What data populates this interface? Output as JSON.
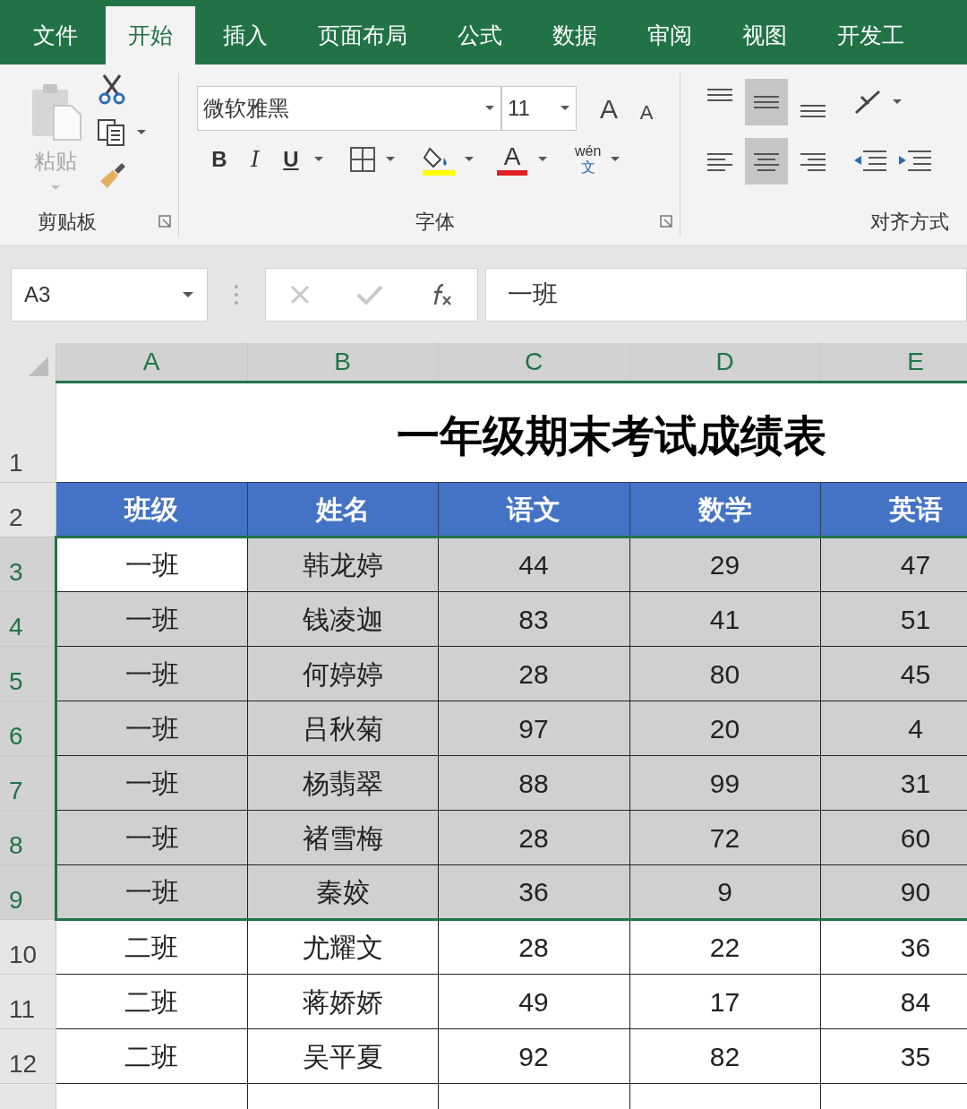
{
  "tabs": [
    {
      "label": "文件",
      "selected": false
    },
    {
      "label": "开始",
      "selected": true
    },
    {
      "label": "插入",
      "selected": false
    },
    {
      "label": "页面布局",
      "selected": false
    },
    {
      "label": "公式",
      "selected": false
    },
    {
      "label": "数据",
      "selected": false
    },
    {
      "label": "审阅",
      "selected": false
    },
    {
      "label": "视图",
      "selected": false
    },
    {
      "label": "开发工",
      "selected": false
    }
  ],
  "ribbon": {
    "clipboard": {
      "paste_label": "粘贴",
      "paste_disabled": true,
      "group_label": "剪贴板"
    },
    "font": {
      "font_name": "微软雅黑",
      "font_size": "11",
      "grow": "A",
      "shrink": "A",
      "bold": "B",
      "italic": "I",
      "underline": "U",
      "font_color": "A",
      "phonetic_top": "wén",
      "phonetic_bottom": "文",
      "group_label": "字体"
    },
    "alignment": {
      "group_label": "对齐方式",
      "middle_align_selected": true,
      "center_selected": true
    }
  },
  "name_box": "A3",
  "formula": "一班",
  "columns": [
    {
      "label": "A",
      "selected": true
    },
    {
      "label": "B",
      "selected": true
    },
    {
      "label": "C",
      "selected": true
    },
    {
      "label": "D",
      "selected": true
    },
    {
      "label": "E",
      "selected": true
    }
  ],
  "title_row": "1",
  "title": "一年级期末考试成绩表",
  "header_row": "2",
  "headers": [
    "班级",
    "姓名",
    "语文",
    "数学",
    "英语"
  ],
  "rows": [
    {
      "number": "3",
      "selected": true,
      "cells": [
        {
          "text": "一班",
          "active": true
        },
        {
          "text": "韩龙婷",
          "active": false
        },
        {
          "text": "44",
          "active": false
        },
        {
          "text": "29",
          "active": false
        },
        {
          "text": "47",
          "active": false
        }
      ]
    },
    {
      "number": "4",
      "selected": true,
      "cells": [
        {
          "text": "一班",
          "active": false
        },
        {
          "text": "钱凌迦",
          "active": false
        },
        {
          "text": "83",
          "active": false
        },
        {
          "text": "41",
          "active": false
        },
        {
          "text": "51",
          "active": false
        }
      ]
    },
    {
      "number": "5",
      "selected": true,
      "cells": [
        {
          "text": "一班",
          "active": false
        },
        {
          "text": "何婷婷",
          "active": false
        },
        {
          "text": "28",
          "active": false
        },
        {
          "text": "80",
          "active": false
        },
        {
          "text": "45",
          "active": false
        }
      ]
    },
    {
      "number": "6",
      "selected": true,
      "cells": [
        {
          "text": "一班",
          "active": false
        },
        {
          "text": "吕秋菊",
          "active": false
        },
        {
          "text": "97",
          "active": false
        },
        {
          "text": "20",
          "active": false
        },
        {
          "text": "4",
          "active": false
        }
      ]
    },
    {
      "number": "7",
      "selected": true,
      "cells": [
        {
          "text": "一班",
          "active": false
        },
        {
          "text": "杨翡翠",
          "active": false
        },
        {
          "text": "88",
          "active": false
        },
        {
          "text": "99",
          "active": false
        },
        {
          "text": "31",
          "active": false
        }
      ]
    },
    {
      "number": "8",
      "selected": true,
      "cells": [
        {
          "text": "一班",
          "active": false
        },
        {
          "text": "褚雪梅",
          "active": false
        },
        {
          "text": "28",
          "active": false
        },
        {
          "text": "72",
          "active": false
        },
        {
          "text": "60",
          "active": false
        }
      ]
    },
    {
      "number": "9",
      "selected": true,
      "cells": [
        {
          "text": "一班",
          "active": false
        },
        {
          "text": "秦姣",
          "active": false
        },
        {
          "text": "36",
          "active": false
        },
        {
          "text": "9",
          "active": false
        },
        {
          "text": "90",
          "active": false
        }
      ]
    },
    {
      "number": "10",
      "selected": false,
      "cells": [
        {
          "text": "二班"
        },
        {
          "text": "尤耀文"
        },
        {
          "text": "28"
        },
        {
          "text": "22"
        },
        {
          "text": "36"
        }
      ]
    },
    {
      "number": "11",
      "selected": false,
      "cells": [
        {
          "text": "二班"
        },
        {
          "text": "蒋娇娇"
        },
        {
          "text": "49"
        },
        {
          "text": "17"
        },
        {
          "text": "84"
        }
      ]
    },
    {
      "number": "12",
      "selected": false,
      "cells": [
        {
          "text": "二班"
        },
        {
          "text": "吴平夏"
        },
        {
          "text": "92"
        },
        {
          "text": "82"
        },
        {
          "text": "35"
        }
      ]
    }
  ]
}
